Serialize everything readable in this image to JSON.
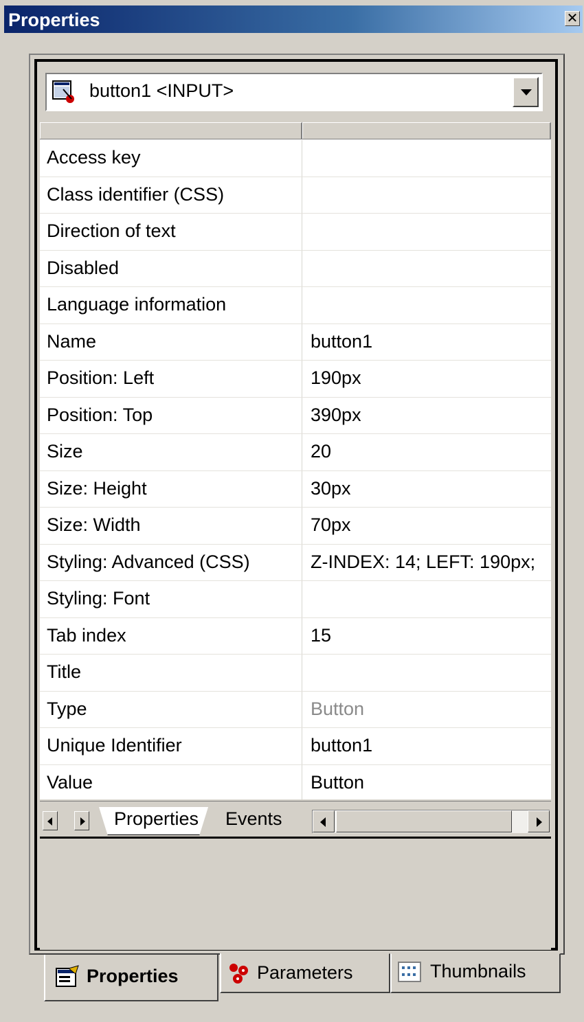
{
  "window": {
    "title": "Properties",
    "close_glyph": "✕"
  },
  "selector": {
    "value": "button1 <INPUT>",
    "icon": "input-element-icon"
  },
  "properties": [
    {
      "name": "Access key",
      "value": ""
    },
    {
      "name": "Class identifier (CSS)",
      "value": ""
    },
    {
      "name": "Direction of text",
      "value": ""
    },
    {
      "name": "Disabled",
      "value": ""
    },
    {
      "name": "Language information",
      "value": ""
    },
    {
      "name": "Name",
      "value": "button1"
    },
    {
      "name": "Position: Left",
      "value": "190px"
    },
    {
      "name": "Position: Top",
      "value": "390px"
    },
    {
      "name": "Size",
      "value": "20"
    },
    {
      "name": "Size: Height",
      "value": "30px"
    },
    {
      "name": "Size: Width",
      "value": "70px"
    },
    {
      "name": "Styling: Advanced (CSS)",
      "value": "Z-INDEX: 14; LEFT: 190px;"
    },
    {
      "name": "Styling: Font",
      "value": ""
    },
    {
      "name": "Tab index",
      "value": "15"
    },
    {
      "name": "Title",
      "value": ""
    },
    {
      "name": "Type",
      "value": "Button",
      "dimmed": true
    },
    {
      "name": "Unique Identifier",
      "value": "button1"
    },
    {
      "name": "Value",
      "value": "Button"
    }
  ],
  "sheet_tabs": {
    "properties": "Properties",
    "events": "Events"
  },
  "bottom_tabs": {
    "properties": "Properties",
    "parameters": "Parameters",
    "thumbnails": "Thumbnails"
  },
  "colors": {
    "titlebar_start": "#0a246a",
    "titlebar_end": "#a6caf0",
    "face": "#d4d0c8",
    "dim_text": "#8a8a8a",
    "accent_red": "#cc0000"
  }
}
